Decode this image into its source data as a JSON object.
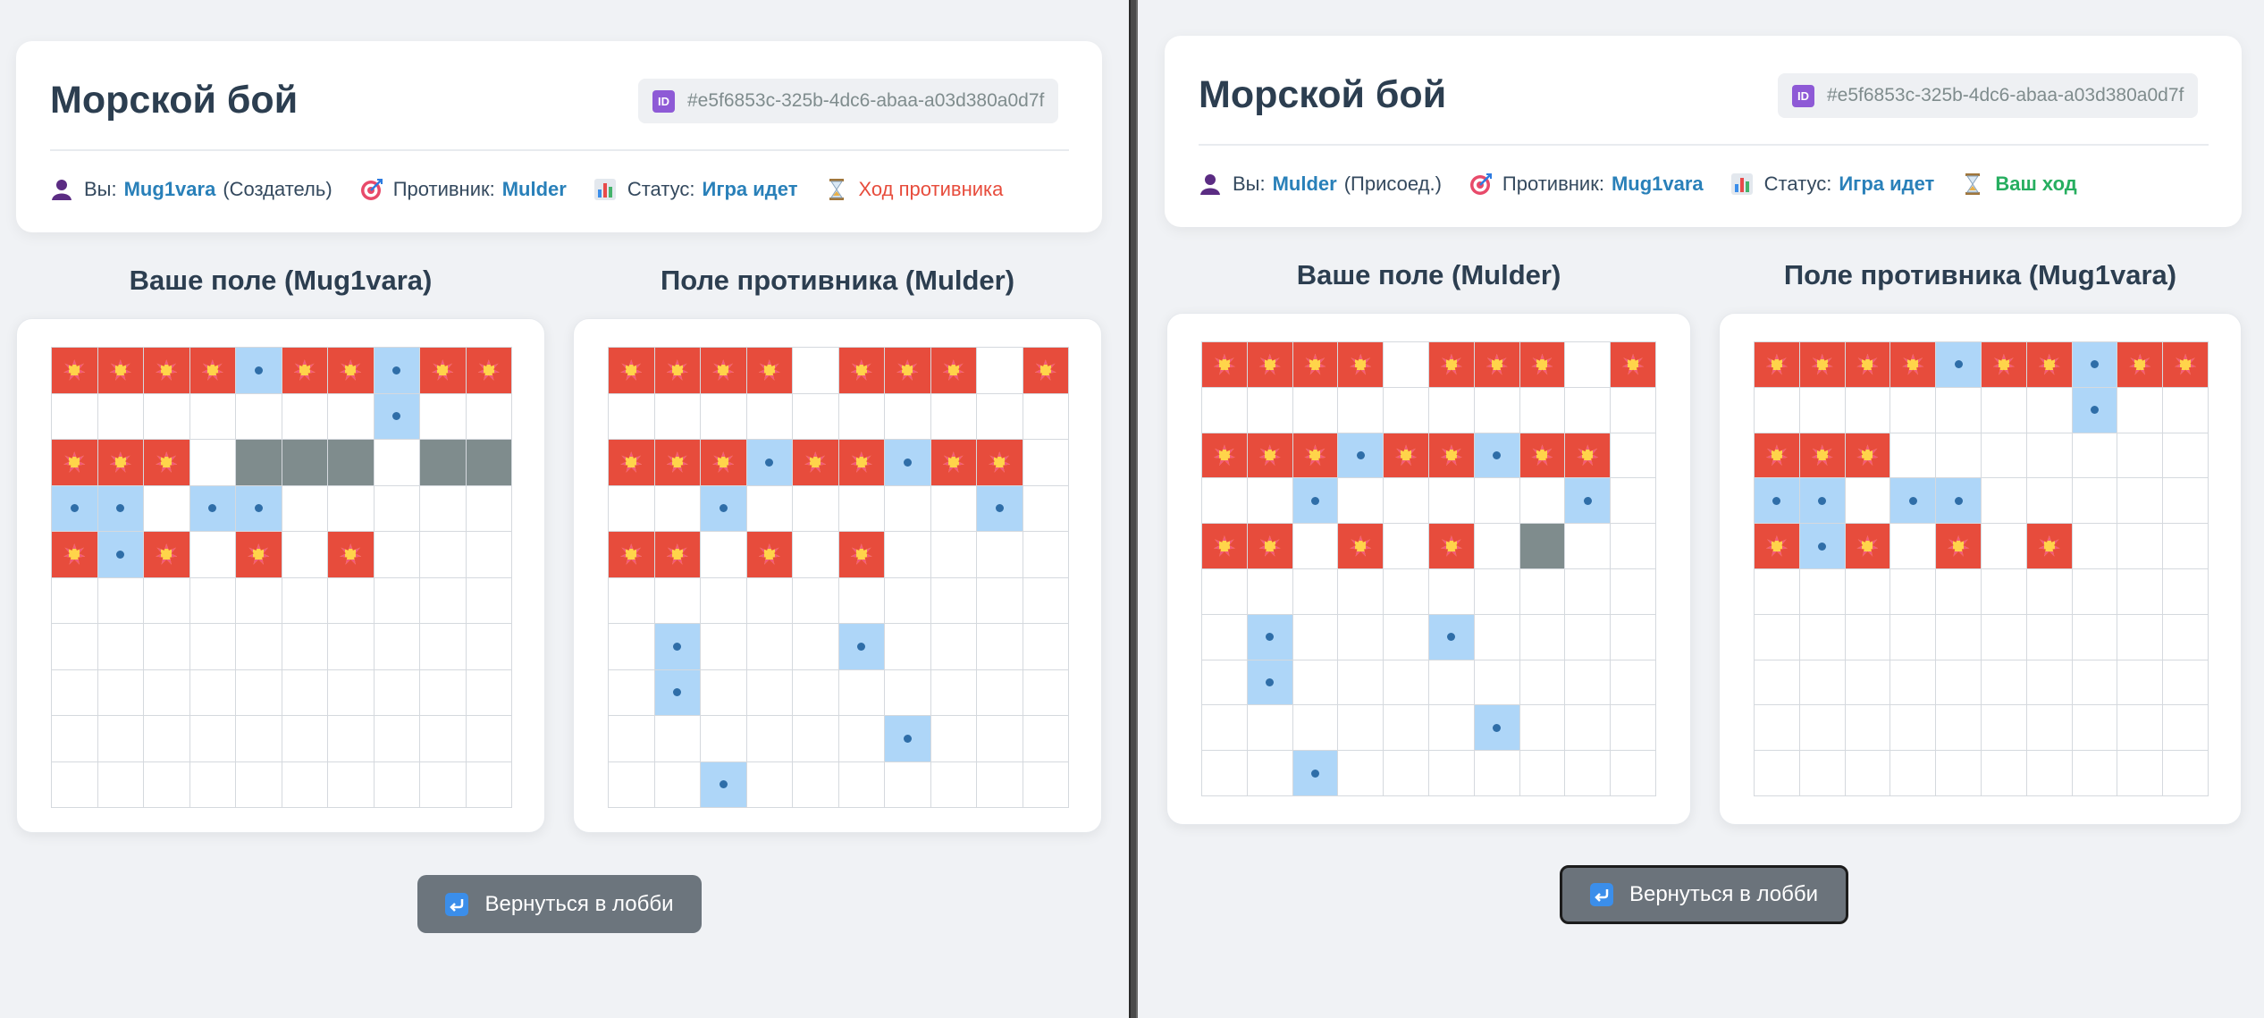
{
  "panes": [
    {
      "title": "Морской бой",
      "game_id": "#e5f6853c-325b-4dc6-abaa-a03d380a0d7f",
      "you_label": "Вы:",
      "you_name": "Mug1vara",
      "you_role": "(Создатель)",
      "opponent_label": "Противник:",
      "opponent_name": "Mulder",
      "status_label": "Статус:",
      "status_value": "Игра идет",
      "turn_text": "Ход противника",
      "turn_color": "#e74c3c",
      "own_board_title": "Ваше поле (Mug1vara)",
      "enemy_board_title": "Поле противника (Mulder)",
      "lobby_button": "Вернуться в лобби",
      "own_board": [
        "HHHHMHHMHH",
        "-------M--",
        "HHH-SSS-SS",
        "MM-MM-----",
        "HMH-H-H---",
        "----------",
        "----------",
        "----------",
        "----------",
        "----------"
      ],
      "enemy_board": [
        "HHHH-HHH-H",
        "----------",
        "HHHMHHMHH-",
        "--M-----M-",
        "HH-H-H----",
        "----------",
        "-M---M----",
        "-M--------",
        "------M---",
        "--M-------"
      ]
    },
    {
      "title": "Морской бой",
      "game_id": "#e5f6853c-325b-4dc6-abaa-a03d380a0d7f",
      "you_label": "Вы:",
      "you_name": "Mulder",
      "you_role": "(Присоед.)",
      "opponent_label": "Противник:",
      "opponent_name": "Mug1vara",
      "status_label": "Статус:",
      "status_value": "Игра идет",
      "turn_text": "Ваш ход",
      "turn_color": "#27ae60",
      "own_board_title": "Ваше поле (Mulder)",
      "enemy_board_title": "Поле противника (Mug1vara)",
      "lobby_button": "Вернуться в лобби",
      "own_board": [
        "HHHH-HHH-H",
        "----------",
        "HHHMHHMHH-",
        "--M-----M-",
        "HH-H-H-S--",
        "----------",
        "-M---M----",
        "-M--------",
        "------M---",
        "--M-------"
      ],
      "enemy_board": [
        "HHHHMHHMHH",
        "-------M--",
        "HHH-------",
        "MM-MM-----",
        "HMH-H-H---",
        "----------",
        "----------",
        "----------",
        "----------",
        "----------"
      ]
    }
  ],
  "legend": {
    "H": "hit",
    "M": "miss",
    "S": "ship",
    "-": "empty"
  }
}
